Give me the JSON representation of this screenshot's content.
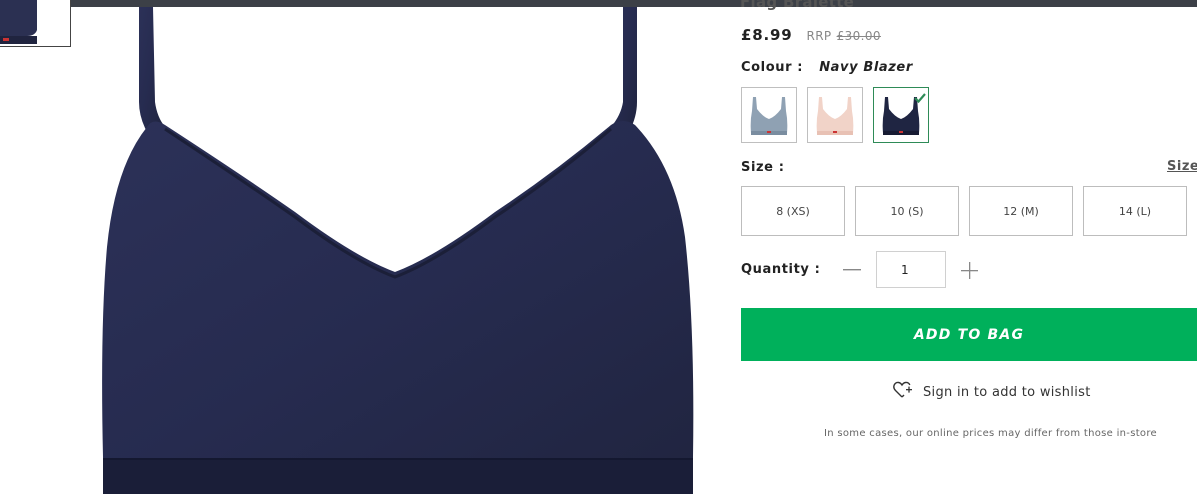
{
  "product": {
    "title_partial": "Flag Bralette",
    "price": "£8.99",
    "rrp_label": "RRP",
    "rrp_value": "£30.00"
  },
  "colour": {
    "label": "Colour :",
    "selected": "Navy Blazer",
    "swatches": [
      {
        "name": "grey-blue",
        "color": "#8fa1b3",
        "selected": false
      },
      {
        "name": "pink",
        "color": "#f1d3c8",
        "selected": false
      },
      {
        "name": "navy-blazer",
        "color": "#1f2542",
        "selected": true
      }
    ],
    "selected_border_color": "#2e8b57"
  },
  "size": {
    "label": "Size :",
    "guide_link": "Size",
    "options": [
      "8 (XS)",
      "10 (S)",
      "12 (M)",
      "14 (L)"
    ]
  },
  "quantity": {
    "label": "Quantity :",
    "value": "1",
    "minus_icon": "minus-icon",
    "plus_icon": "plus-icon"
  },
  "actions": {
    "add_to_bag": "ADD TO BAG",
    "wishlist": "Sign in to add to wishlist",
    "accent_color": "#00b05b"
  },
  "disclaimer": "In some cases, our online prices may differ from those in-store",
  "image": {
    "product_color": "#262b4f"
  }
}
